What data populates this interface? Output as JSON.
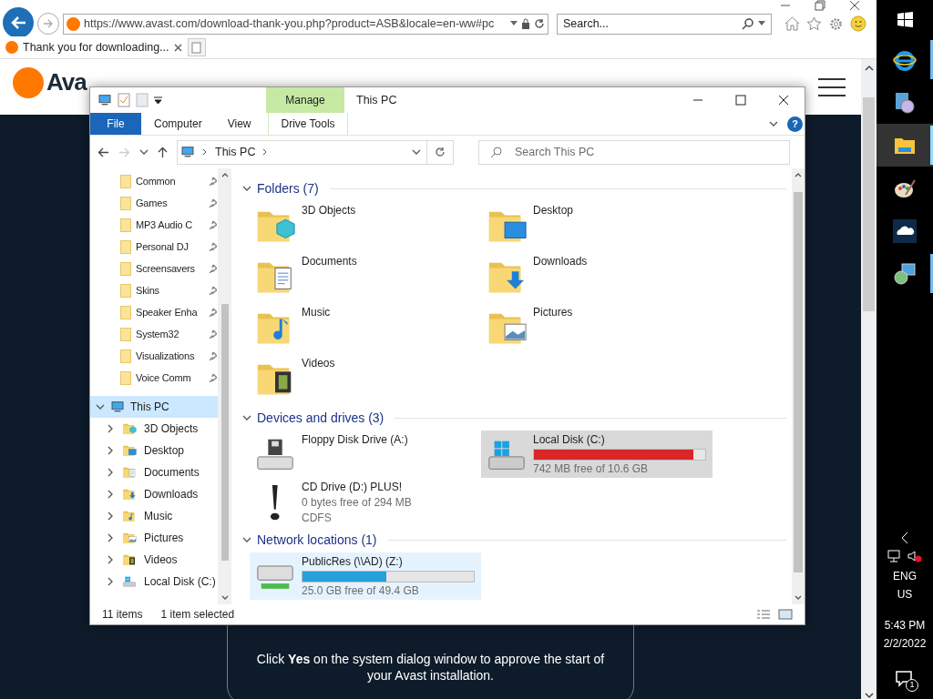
{
  "browser": {
    "address": "https://www.avast.com/download-thank-you.php?product=ASB&locale=en-ww#pc",
    "search_placeholder": "Search...",
    "tab_title": "Thank you for downloading..."
  },
  "page": {
    "logo_text": "Ava",
    "card_text": "Click **Yes** on the system dialog window to approve the start of your Avast installation."
  },
  "explorer": {
    "context_tab": "Manage",
    "title": "This PC",
    "ribbon_tabs": [
      {
        "label": "File",
        "kind": "file"
      },
      {
        "label": "Computer",
        "kind": "tab"
      },
      {
        "label": "View",
        "kind": "tab"
      },
      {
        "label": "Drive Tools",
        "kind": "context"
      }
    ],
    "help_label": "?",
    "breadcrumb": [
      "This PC"
    ],
    "search_placeholder": "Search This PC",
    "quick_access": [
      {
        "label": "Common"
      },
      {
        "label": "Games"
      },
      {
        "label": "MP3 Audio C"
      },
      {
        "label": "Personal DJ"
      },
      {
        "label": "Screensavers"
      },
      {
        "label": "Skins"
      },
      {
        "label": "Speaker Enha"
      },
      {
        "label": "System32"
      },
      {
        "label": "Visualizations"
      },
      {
        "label": "Voice Comm"
      }
    ],
    "tree": [
      {
        "label": "This PC",
        "kind": "pc",
        "expanded": true,
        "selected": true,
        "children": [
          {
            "label": "3D Objects",
            "kind": "objects",
            "expanded": false,
            "selected": false
          },
          {
            "label": "Desktop",
            "kind": "desktop",
            "expanded": false,
            "selected": false
          },
          {
            "label": "Documents",
            "kind": "documents",
            "expanded": false,
            "selected": false
          },
          {
            "label": "Downloads",
            "kind": "downloads",
            "expanded": false,
            "selected": false
          },
          {
            "label": "Music",
            "kind": "music",
            "expanded": false,
            "selected": false
          },
          {
            "label": "Pictures",
            "kind": "pictures",
            "expanded": false,
            "selected": false
          },
          {
            "label": "Videos",
            "kind": "videos",
            "expanded": false,
            "selected": false
          },
          {
            "label": "Local Disk (C:)",
            "kind": "disk",
            "expanded": false,
            "selected": false
          }
        ]
      }
    ],
    "groups": [
      {
        "title": "Folders (7)",
        "expanded": true,
        "items": [
          {
            "name": "3D Objects",
            "kind": "objects",
            "selected": false
          },
          {
            "name": "Desktop",
            "kind": "desktop",
            "selected": false
          },
          {
            "name": "Documents",
            "kind": "documents",
            "selected": false
          },
          {
            "name": "Downloads",
            "kind": "downloads",
            "selected": false
          },
          {
            "name": "Music",
            "kind": "music",
            "selected": false
          },
          {
            "name": "Pictures",
            "kind": "pictures",
            "selected": false
          },
          {
            "name": "Videos",
            "kind": "videos",
            "selected": false
          }
        ]
      },
      {
        "title": "Devices and drives (3)",
        "expanded": true,
        "items": [
          {
            "name": "Floppy Disk Drive (A:)",
            "kind": "floppy",
            "selected": false
          },
          {
            "name": "Local Disk (C:)",
            "kind": "disk",
            "selected": true,
            "level": 0.93,
            "low_space": true,
            "details": [
              "742 MB free of 10.6 GB"
            ]
          },
          {
            "name": "CD Drive (D:) PLUS!",
            "kind": "cd",
            "selected": false,
            "details": [
              "0 bytes free of 294 MB",
              "CDFS"
            ]
          }
        ]
      },
      {
        "title": "Network locations (1)",
        "expanded": true,
        "items": [
          {
            "name": "PublicRes (\\\\AD) (Z:)",
            "kind": "network",
            "selected": true,
            "level": 0.49,
            "low_space": false,
            "details": [
              "25.0 GB free of 49.4 GB"
            ]
          }
        ]
      }
    ],
    "status": {
      "count": "11 items",
      "selection": "1 item selected"
    }
  },
  "taskbar": {
    "apps": [
      {
        "kind": "ie",
        "active": false,
        "running": true
      },
      {
        "kind": "setup",
        "active": false,
        "running": false
      },
      {
        "kind": "explorer",
        "active": true,
        "running": true
      },
      {
        "kind": "paint",
        "active": false,
        "running": false
      },
      {
        "kind": "cloud",
        "active": false,
        "running": false
      },
      {
        "kind": "installer",
        "active": false,
        "running": true
      }
    ],
    "language": "ENG",
    "region": "US",
    "time": "5:43 PM",
    "date": "2/2/2022",
    "notifications": "1"
  }
}
